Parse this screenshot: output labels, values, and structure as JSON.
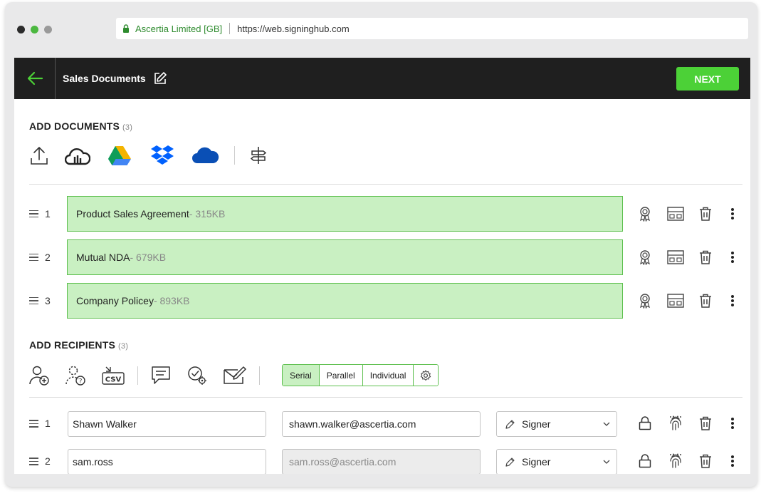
{
  "browser": {
    "site_name": "Ascertia Limited [GB]",
    "url": "https://web.signinghub.com",
    "dot_colors": [
      "#2b2b2b",
      "#4cb840",
      "#9a9a9a"
    ]
  },
  "header": {
    "title": "Sales Documents",
    "next_label": "NEXT",
    "accent_color": "#4cd137"
  },
  "documents": {
    "title": "ADD DOCUMENTS",
    "count": "(3)",
    "tools": [
      "upload-icon",
      "cloud-drive-icon",
      "google-drive-icon",
      "dropbox-icon",
      "onedrive-icon",
      "signpost-icon"
    ],
    "items": [
      {
        "num": "1",
        "name": "Product Sales Agreement",
        "size": " - 315KB"
      },
      {
        "num": "2",
        "name": "Mutual NDA",
        "size": " - 679KB"
      },
      {
        "num": "3",
        "name": "Company Policey",
        "size": " - 893KB"
      }
    ]
  },
  "recipients": {
    "title": "ADD RECIPIENTS",
    "count": "(3)",
    "tools": [
      "add-user-icon",
      "placeholder-user-icon",
      "csv-import-icon",
      "comment-icon",
      "settings-check-icon",
      "sign-envelope-icon"
    ],
    "modes": [
      "Serial",
      "Parallel",
      "Individual"
    ],
    "active_mode": "Serial",
    "items": [
      {
        "num": "1",
        "name": "Shawn Walker",
        "email": "shawn.walker@ascertia.com",
        "role": "Signer",
        "email_disabled": false
      },
      {
        "num": "2",
        "name": "sam.ross",
        "email": "sam.ross@ascertia.com",
        "role": "Signer",
        "email_disabled": true
      }
    ]
  }
}
